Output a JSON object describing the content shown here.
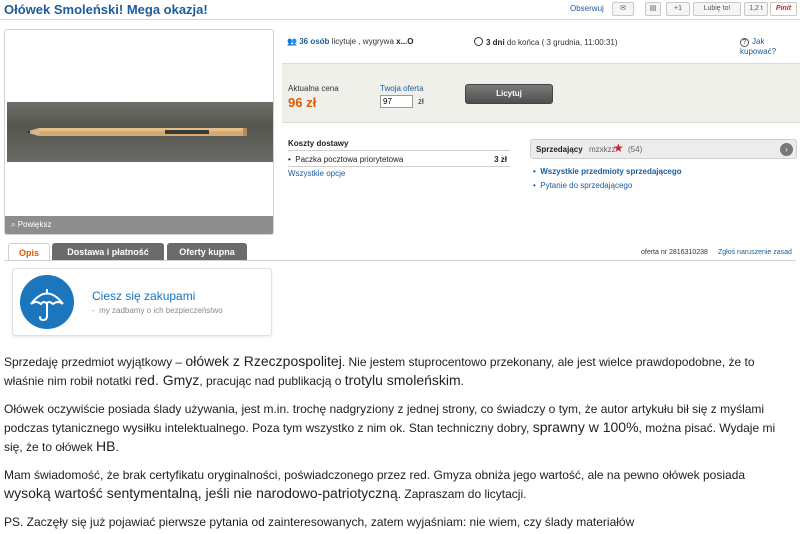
{
  "header": {
    "title": "Ołówek Smoleński! Mega okazja!",
    "watch_label": "Obserwuj",
    "like_label": "Lubię to!",
    "like_count": "1,2 t",
    "gplus_label": "+1",
    "pin_label": "Pinit"
  },
  "gallery": {
    "zoom_label": "Powiększ"
  },
  "auction": {
    "bidders_count": "36 osób",
    "bidders_text": "licytuje , wygrywa",
    "winner": "x...O",
    "time_left": "3 dni",
    "time_text": "do końca ( 3 grudnia, 11:00:31)",
    "how_to_buy": "Jak kupować?"
  },
  "price": {
    "current_label": "Aktualna cena",
    "current_value": "96 zł",
    "offer_label": "Twoja oferta",
    "offer_value": "97",
    "currency": "zł",
    "bid_button": "Licytuj"
  },
  "shipping": {
    "heading": "Koszty dostawy",
    "rows": [
      {
        "name": "Paczka pocztowa priorytetowa",
        "price": "3 zł"
      }
    ],
    "all_options": "Wszystkie opcje"
  },
  "seller": {
    "label": "Sprzedający",
    "nick": "mzxkzz",
    "rating": "(54)",
    "links": [
      "Wszystkie przedmioty sprzedającego",
      "Pytanie do sprzedającego"
    ]
  },
  "tabs": [
    {
      "label": "Opis",
      "active": true
    },
    {
      "label": "Dostawa i płatność",
      "active": false
    },
    {
      "label": "Oferty kupna",
      "active": false
    }
  ],
  "offer_number": "oferta nr 2816310238",
  "report_label": "Zgłoś naruszenie zasad",
  "safety": {
    "title": "Ciesz się zakupami",
    "subtitle": "my zadbamy o ich bezpieczeństwo"
  },
  "description": {
    "p1": [
      "Sprzedaję przedmiot wyjątkowy – ",
      "ołówek z Rzeczpospolitej",
      ". Nie jestem stuprocentowo przekonany, ale jest wielce prawdopodobne, że to właśnie nim robił notatki ",
      "red. Gmyz",
      ", pracując nad publikacją o ",
      "trotylu smoleńskim",
      "."
    ],
    "p2": [
      "Ołówek oczywiście posiada ślady używania, jest m.in. trochę nadgryziony z jednej strony, co świadczy o tym, że autor artykułu bił się z myślami podczas tytanicznego wysiłku intelektualnego. Poza tym wszystko z nim ok. Stan techniczny dobry, ",
      "sprawny w 100%",
      ", można pisać. Wydaje mi się, że to ołówek ",
      "HB",
      "."
    ],
    "p3": [
      "Mam świadomość, że brak certyfikatu oryginalności, poświadczonego przez red. Gmyza obniża jego wartość, ale na pewno ołówek posiada ",
      "wysoką wartość sentymentalną, jeśli nie narodowo-patriotyczną",
      ". Zapraszam do licytacji."
    ],
    "p4": "PS. Zaczęły się już pojawiać pierwsze pytania od zainteresowanych, zatem wyjaśniam: nie wiem, czy ślady materiałów"
  },
  "colors": {
    "link": "#1d5c9c",
    "price": "#e05a00",
    "umbrella": "#1b76bd"
  }
}
